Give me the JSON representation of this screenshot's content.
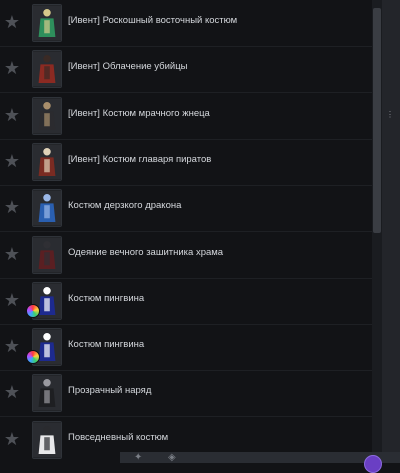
{
  "items": [
    {
      "label": "[Ивент] Роскошный восточный костюм",
      "icon": "costume-green-icon",
      "color": "#2e8f5c",
      "accent": "#d6c98b",
      "badge": false
    },
    {
      "label": "[Ивент] Облачение убийцы",
      "icon": "costume-red-icon",
      "color": "#8b2a22",
      "accent": "#3a2a25",
      "badge": false
    },
    {
      "label": "[Ивент] Костюм мрачного жнеца",
      "icon": "costume-dark-icon",
      "color": "#2b2b2f",
      "accent": "#a88e6b",
      "badge": false
    },
    {
      "label": "[Ивент] Костюм главаря пиратов",
      "icon": "costume-pirate-icon",
      "color": "#7a2b22",
      "accent": "#e0d2b8",
      "badge": false
    },
    {
      "label": "Костюм дерзкого дракона",
      "icon": "costume-blue-icon",
      "color": "#2a5fb0",
      "accent": "#9bb8e8",
      "badge": false
    },
    {
      "label": "Одеяние вечного зашитника храма",
      "icon": "costume-red-dark-icon",
      "color": "#5a1f22",
      "accent": "#2f2f34",
      "badge": false
    },
    {
      "label": "Костюм пингвина",
      "icon": "penguin-costume-icon",
      "color": "#1d2a8f",
      "accent": "#ffffff",
      "badge": true
    },
    {
      "label": "Костюм пингвина",
      "icon": "penguin-costume-icon",
      "color": "#1d2a8f",
      "accent": "#ffffff",
      "badge": true
    },
    {
      "label": "Прозрачный наряд",
      "icon": "costume-black-icon",
      "color": "#1e1f22",
      "accent": "#9a9aa0",
      "badge": false
    },
    {
      "label": "Повседневный костюм",
      "icon": "costume-white-icon",
      "color": "#e8e8ea",
      "accent": "#2a2b2f",
      "badge": false
    }
  ],
  "star_glyph": "★"
}
